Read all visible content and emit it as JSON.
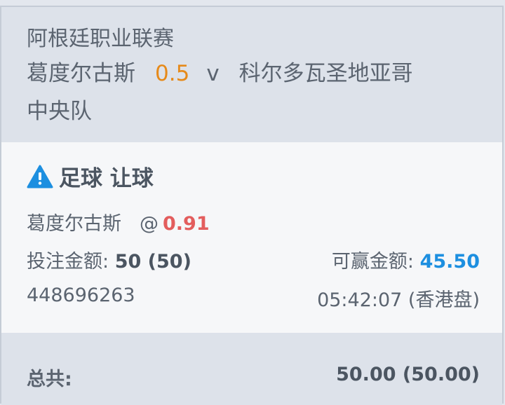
{
  "match": {
    "league": "阿根廷职业联赛",
    "home_team": "葛度尔古斯",
    "handicap": "0.5",
    "vs": "v",
    "away_team_line1": "科尔多瓦圣地亚哥",
    "away_team_line2": "中央队"
  },
  "bet": {
    "type_label": "足球 让球",
    "selection": "葛度尔古斯",
    "odds_prefix": "@",
    "odds": "0.91",
    "stake_label": "投注金额:",
    "stake_value": "50 (50)",
    "payout_label": "可赢金额:",
    "payout_value": "45.50",
    "ticket_id": "448696263",
    "time": "05:42:07 (香港盘)"
  },
  "total": {
    "label": "总共:",
    "value": "50.00 (50.00)"
  },
  "colors": {
    "handicap": "#e68a1a",
    "odds": "#e35d5d",
    "payout": "#1d8fe0",
    "warning_icon": "#1d8fe0"
  }
}
